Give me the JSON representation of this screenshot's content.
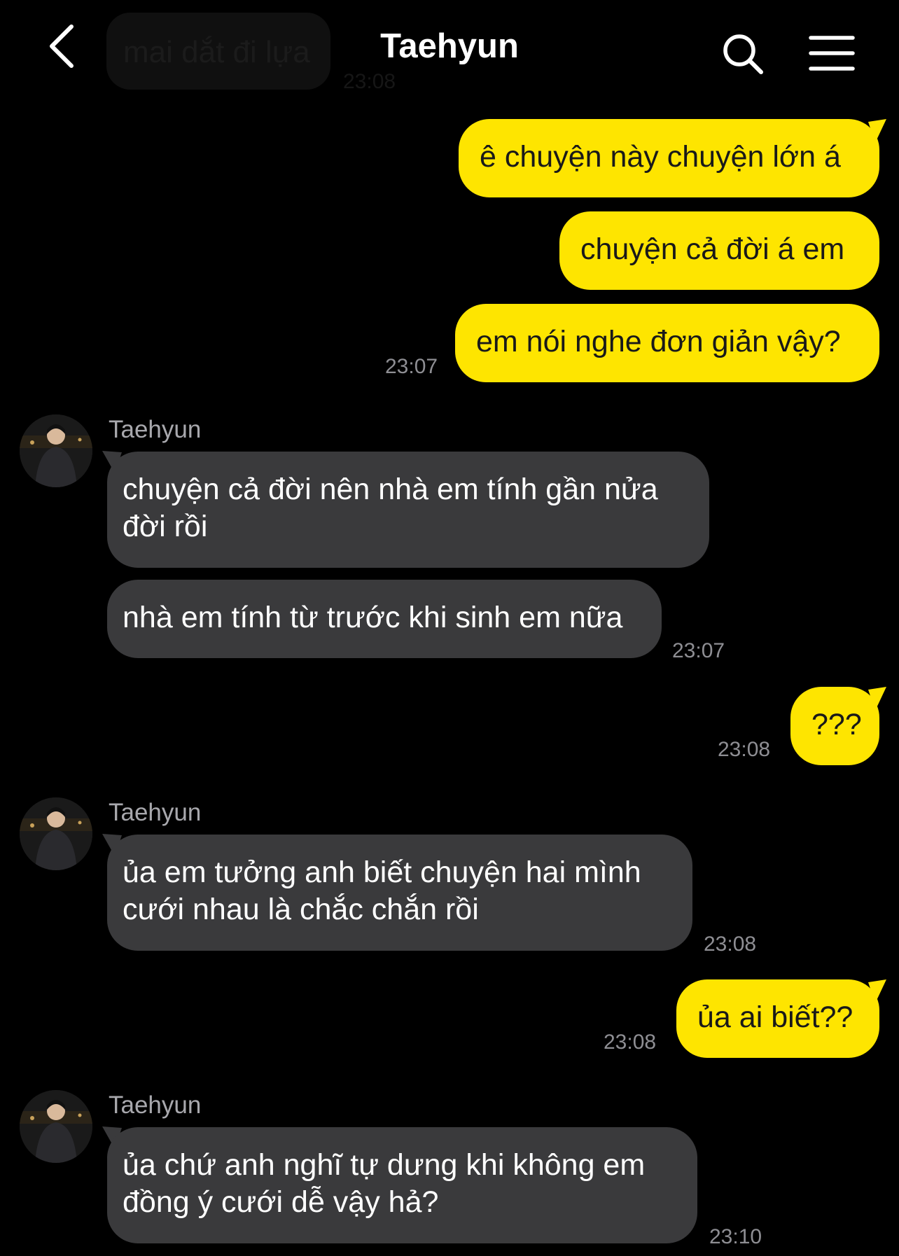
{
  "header": {
    "title": "Taehyun"
  },
  "previous_message": {
    "text": "mai dắt đi lựa",
    "time": "23:08"
  },
  "contact": {
    "name": "Taehyun"
  },
  "messages": [
    {
      "text": "ê chuyện này chuyện lớn á"
    },
    {
      "text": "chuyện cả đời á em"
    },
    {
      "text": "em nói nghe đơn giản vậy?",
      "time": "23:07"
    },
    {
      "text": "chuyện cả đời nên nhà em tính gần nửa\nđời rồi"
    },
    {
      "text": "nhà em tính từ trước khi sinh em nữa",
      "time": "23:07"
    },
    {
      "text": "???",
      "time": "23:08"
    },
    {
      "text": "ủa em tưởng anh biết chuyện hai mình\ncưới nhau là chắc chắn rồi",
      "time": "23:08"
    },
    {
      "text": "ủa ai biết??",
      "time": "23:08"
    },
    {
      "text": "ủa chứ anh nghĩ tự dưng khi không em\nđồng ý cưới dễ vậy hả?",
      "time": "23:10"
    }
  ]
}
